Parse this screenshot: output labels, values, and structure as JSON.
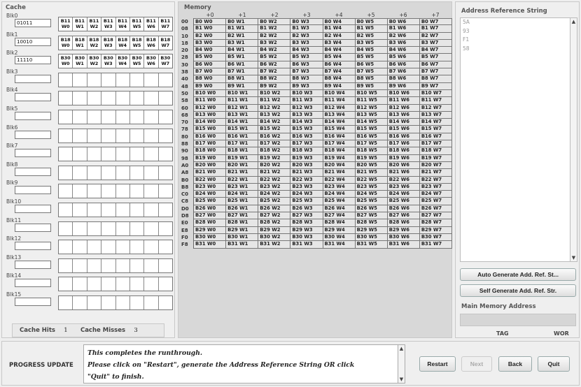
{
  "cache": {
    "title": "Cache",
    "blocks": [
      {
        "label": "Blk0",
        "tag": "01011",
        "words": [
          "B11\nW0",
          "B11\nW1",
          "B11\nW2",
          "B11\nW3",
          "B11\nW4",
          "B11\nW5",
          "B11\nW6",
          "B11\nW7"
        ]
      },
      {
        "label": "Blk1",
        "tag": "10010",
        "words": [
          "B18\nW0",
          "B18\nW1",
          "B18\nW2",
          "B18\nW3",
          "B18\nW4",
          "B18\nW5",
          "B18\nW6",
          "B18\nW7"
        ]
      },
      {
        "label": "Blk2",
        "tag": "11110",
        "words": [
          "B30\nW0",
          "B30\nW1",
          "B30\nW2",
          "B30\nW3",
          "B30\nW4",
          "B30\nW5",
          "B30\nW6",
          "B30\nW7"
        ]
      },
      {
        "label": "Blk3",
        "tag": "",
        "words": [
          "",
          "",
          "",
          "",
          "",
          "",
          "",
          ""
        ]
      },
      {
        "label": "Blk4",
        "tag": "",
        "words": [
          "",
          "",
          "",
          "",
          "",
          "",
          "",
          ""
        ]
      },
      {
        "label": "Blk5",
        "tag": "",
        "words": [
          "",
          "",
          "",
          "",
          "",
          "",
          "",
          ""
        ]
      },
      {
        "label": "Blk6",
        "tag": "",
        "words": [
          "",
          "",
          "",
          "",
          "",
          "",
          "",
          ""
        ]
      },
      {
        "label": "Blk7",
        "tag": "",
        "words": [
          "",
          "",
          "",
          "",
          "",
          "",
          "",
          ""
        ]
      },
      {
        "label": "Blk8",
        "tag": "",
        "words": [
          "",
          "",
          "",
          "",
          "",
          "",
          "",
          ""
        ]
      },
      {
        "label": "Blk9",
        "tag": "",
        "words": [
          "",
          "",
          "",
          "",
          "",
          "",
          "",
          ""
        ]
      },
      {
        "label": "Blk10",
        "tag": "",
        "words": [
          "",
          "",
          "",
          "",
          "",
          "",
          "",
          ""
        ]
      },
      {
        "label": "Blk11",
        "tag": "",
        "words": [
          "",
          "",
          "",
          "",
          "",
          "",
          "",
          ""
        ]
      },
      {
        "label": "Blk12",
        "tag": "",
        "words": [
          "",
          "",
          "",
          "",
          "",
          "",
          "",
          ""
        ]
      },
      {
        "label": "Blk13",
        "tag": "",
        "words": [
          "",
          "",
          "",
          "",
          "",
          "",
          "",
          ""
        ]
      },
      {
        "label": "Blk14",
        "tag": "",
        "words": [
          "",
          "",
          "",
          "",
          "",
          "",
          "",
          ""
        ]
      },
      {
        "label": "Blk15",
        "tag": "",
        "words": [
          "",
          "",
          "",
          "",
          "",
          "",
          "",
          ""
        ]
      }
    ],
    "hits_label": "Cache Hits",
    "hits_value": "1",
    "misses_label": "Cache Misses",
    "misses_value": "3"
  },
  "memory": {
    "title": "Memory",
    "col_headers": [
      "+0",
      "+1",
      "+2",
      "+3",
      "+4",
      "+5",
      "+6",
      "+7"
    ],
    "rows": [
      {
        "addr": "00",
        "cells": [
          "B0 W0",
          "B0 W1",
          "B0 W2",
          "B0 W3",
          "B0 W4",
          "B0 W5",
          "B0 W6",
          "B0 W7"
        ]
      },
      {
        "addr": "08",
        "cells": [
          "B1 W0",
          "B1 W1",
          "B1 W2",
          "B1 W3",
          "B1 W4",
          "B1 W5",
          "B1 W6",
          "B1 W7"
        ]
      },
      {
        "addr": "10",
        "cells": [
          "B2 W0",
          "B2 W1",
          "B2 W2",
          "B2 W3",
          "B2 W4",
          "B2 W5",
          "B2 W6",
          "B2 W7"
        ]
      },
      {
        "addr": "18",
        "cells": [
          "B3 W0",
          "B3 W1",
          "B3 W2",
          "B3 W3",
          "B3 W4",
          "B3 W5",
          "B3 W6",
          "B3 W7"
        ]
      },
      {
        "addr": "20",
        "cells": [
          "B4 W0",
          "B4 W1",
          "B4 W2",
          "B4 W3",
          "B4 W4",
          "B4 W5",
          "B4 W6",
          "B4 W7"
        ]
      },
      {
        "addr": "28",
        "cells": [
          "B5 W0",
          "B5 W1",
          "B5 W2",
          "B5 W3",
          "B5 W4",
          "B5 W5",
          "B5 W6",
          "B5 W7"
        ]
      },
      {
        "addr": "30",
        "cells": [
          "B6 W0",
          "B6 W1",
          "B6 W2",
          "B6 W3",
          "B6 W4",
          "B6 W5",
          "B6 W6",
          "B6 W7"
        ]
      },
      {
        "addr": "38",
        "cells": [
          "B7 W0",
          "B7 W1",
          "B7 W2",
          "B7 W3",
          "B7 W4",
          "B7 W5",
          "B7 W6",
          "B7 W7"
        ]
      },
      {
        "addr": "40",
        "cells": [
          "B8 W0",
          "B8 W1",
          "B8 W2",
          "B8 W3",
          "B8 W4",
          "B8 W5",
          "B8 W6",
          "B8 W7"
        ]
      },
      {
        "addr": "48",
        "cells": [
          "B9 W0",
          "B9 W1",
          "B9 W2",
          "B9 W3",
          "B9 W4",
          "B9 W5",
          "B9 W6",
          "B9 W7"
        ]
      },
      {
        "addr": "50",
        "cells": [
          "B10 W0",
          "B10 W1",
          "B10 W2",
          "B10 W3",
          "B10 W4",
          "B10 W5",
          "B10 W6",
          "B10 W7"
        ]
      },
      {
        "addr": "58",
        "cells": [
          "B11 W0",
          "B11 W1",
          "B11 W2",
          "B11 W3",
          "B11 W4",
          "B11 W5",
          "B11 W6",
          "B11 W7"
        ]
      },
      {
        "addr": "60",
        "cells": [
          "B12 W0",
          "B12 W1",
          "B12 W2",
          "B12 W3",
          "B12 W4",
          "B12 W5",
          "B12 W6",
          "B12 W7"
        ]
      },
      {
        "addr": "68",
        "cells": [
          "B13 W0",
          "B13 W1",
          "B13 W2",
          "B13 W3",
          "B13 W4",
          "B13 W5",
          "B13 W6",
          "B13 W7"
        ]
      },
      {
        "addr": "70",
        "cells": [
          "B14 W0",
          "B14 W1",
          "B14 W2",
          "B14 W3",
          "B14 W4",
          "B14 W5",
          "B14 W6",
          "B14 W7"
        ]
      },
      {
        "addr": "78",
        "cells": [
          "B15 W0",
          "B15 W1",
          "B15 W2",
          "B15 W3",
          "B15 W4",
          "B15 W5",
          "B15 W6",
          "B15 W7"
        ]
      },
      {
        "addr": "80",
        "cells": [
          "B16 W0",
          "B16 W1",
          "B16 W2",
          "B16 W3",
          "B16 W4",
          "B16 W5",
          "B16 W6",
          "B16 W7"
        ]
      },
      {
        "addr": "88",
        "cells": [
          "B17 W0",
          "B17 W1",
          "B17 W2",
          "B17 W3",
          "B17 W4",
          "B17 W5",
          "B17 W6",
          "B17 W7"
        ]
      },
      {
        "addr": "90",
        "cells": [
          "B18 W0",
          "B18 W1",
          "B18 W2",
          "B18 W3",
          "B18 W4",
          "B18 W5",
          "B18 W6",
          "B18 W7"
        ]
      },
      {
        "addr": "98",
        "cells": [
          "B19 W0",
          "B19 W1",
          "B19 W2",
          "B19 W3",
          "B19 W4",
          "B19 W5",
          "B19 W6",
          "B19 W7"
        ]
      },
      {
        "addr": "A0",
        "cells": [
          "B20 W0",
          "B20 W1",
          "B20 W2",
          "B20 W3",
          "B20 W4",
          "B20 W5",
          "B20 W6",
          "B20 W7"
        ]
      },
      {
        "addr": "A8",
        "cells": [
          "B21 W0",
          "B21 W1",
          "B21 W2",
          "B21 W3",
          "B21 W4",
          "B21 W5",
          "B21 W6",
          "B21 W7"
        ]
      },
      {
        "addr": "B0",
        "cells": [
          "B22 W0",
          "B22 W1",
          "B22 W2",
          "B22 W3",
          "B22 W4",
          "B22 W5",
          "B22 W6",
          "B22 W7"
        ]
      },
      {
        "addr": "B8",
        "cells": [
          "B23 W0",
          "B23 W1",
          "B23 W2",
          "B23 W3",
          "B23 W4",
          "B23 W5",
          "B23 W6",
          "B23 W7"
        ]
      },
      {
        "addr": "C0",
        "cells": [
          "B24 W0",
          "B24 W1",
          "B24 W2",
          "B24 W3",
          "B24 W4",
          "B24 W5",
          "B24 W6",
          "B24 W7"
        ]
      },
      {
        "addr": "C8",
        "cells": [
          "B25 W0",
          "B25 W1",
          "B25 W2",
          "B25 W3",
          "B25 W4",
          "B25 W5",
          "B25 W6",
          "B25 W7"
        ]
      },
      {
        "addr": "D0",
        "cells": [
          "B26 W0",
          "B26 W1",
          "B26 W2",
          "B26 W3",
          "B26 W4",
          "B26 W5",
          "B26 W6",
          "B26 W7"
        ]
      },
      {
        "addr": "D8",
        "cells": [
          "B27 W0",
          "B27 W1",
          "B27 W2",
          "B27 W3",
          "B27 W4",
          "B27 W5",
          "B27 W6",
          "B27 W7"
        ]
      },
      {
        "addr": "E0",
        "cells": [
          "B28 W0",
          "B28 W1",
          "B28 W2",
          "B28 W3",
          "B28 W4",
          "B28 W5",
          "B28 W6",
          "B28 W7"
        ]
      },
      {
        "addr": "E8",
        "cells": [
          "B29 W0",
          "B29 W1",
          "B29 W2",
          "B29 W3",
          "B29 W4",
          "B29 W5",
          "B29 W6",
          "B29 W7"
        ]
      },
      {
        "addr": "F0",
        "cells": [
          "B30 W0",
          "B30 W1",
          "B30 W2",
          "B30 W3",
          "B30 W4",
          "B30 W5",
          "B30 W6",
          "B30 W7"
        ]
      },
      {
        "addr": "F8",
        "cells": [
          "B31 W0",
          "B31 W1",
          "B31 W2",
          "B31 W3",
          "B31 W4",
          "B31 W5",
          "B31 W6",
          "B31 W7"
        ]
      }
    ]
  },
  "address_ref": {
    "title": "Address Reference String",
    "items": [
      "5A",
      "93",
      "F1",
      "58"
    ],
    "auto_button": "Auto Generate Add. Ref. St...",
    "self_button": "Self Generate Add. Ref. Str.",
    "main_memory_label": "Main Memory Address",
    "main_memory_value": "",
    "tag_label": "TAG",
    "word_label": "WOR"
  },
  "progress": {
    "label": "PROGRESS UPDATE",
    "lines": [
      "This completes the runthrough.",
      "Please click on \"Restart\", generate the Address Reference String OR click",
      "\"Quit\" to finish."
    ]
  },
  "buttons": {
    "restart": "Restart",
    "next": "Next",
    "back": "Back",
    "quit": "Quit"
  }
}
